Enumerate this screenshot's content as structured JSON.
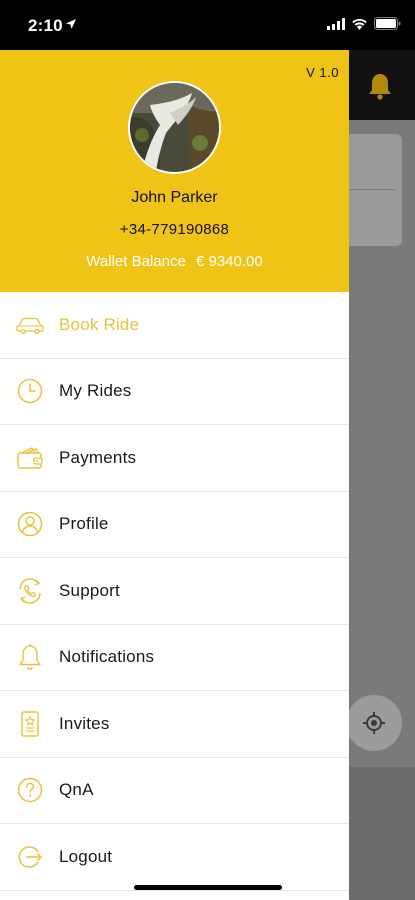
{
  "status_bar": {
    "time": "2:10",
    "icons": [
      "location-arrow-icon",
      "signal-icon",
      "wifi-icon",
      "battery-icon"
    ]
  },
  "colors": {
    "brand_yellow": "#f0c417",
    "accent_icon": "#e8c23a",
    "wallet_text": "#ffffff"
  },
  "drawer": {
    "version": "V 1.0",
    "user": {
      "name": "John Parker",
      "phone": "+34-779190868"
    },
    "wallet": {
      "label": "Wallet Balance",
      "amount": "€ 9340.00"
    },
    "menu": [
      {
        "label": "Book Ride",
        "icon": "car-icon",
        "active": true
      },
      {
        "label": "My Rides",
        "icon": "clock-icon",
        "active": false
      },
      {
        "label": "Payments",
        "icon": "wallet-icon",
        "active": false
      },
      {
        "label": "Profile",
        "icon": "user-icon",
        "active": false
      },
      {
        "label": "Support",
        "icon": "support-phone-icon",
        "active": false
      },
      {
        "label": "Notifications",
        "icon": "bell-icon",
        "active": false
      },
      {
        "label": "Invites",
        "icon": "invite-card-icon",
        "active": false
      },
      {
        "label": "QnA",
        "icon": "question-icon",
        "active": false
      },
      {
        "label": "Logout",
        "icon": "logout-icon",
        "active": false
      }
    ]
  },
  "background": {
    "topbar_icon": "bell-icon",
    "map_button_icon": "locate-me-icon"
  }
}
